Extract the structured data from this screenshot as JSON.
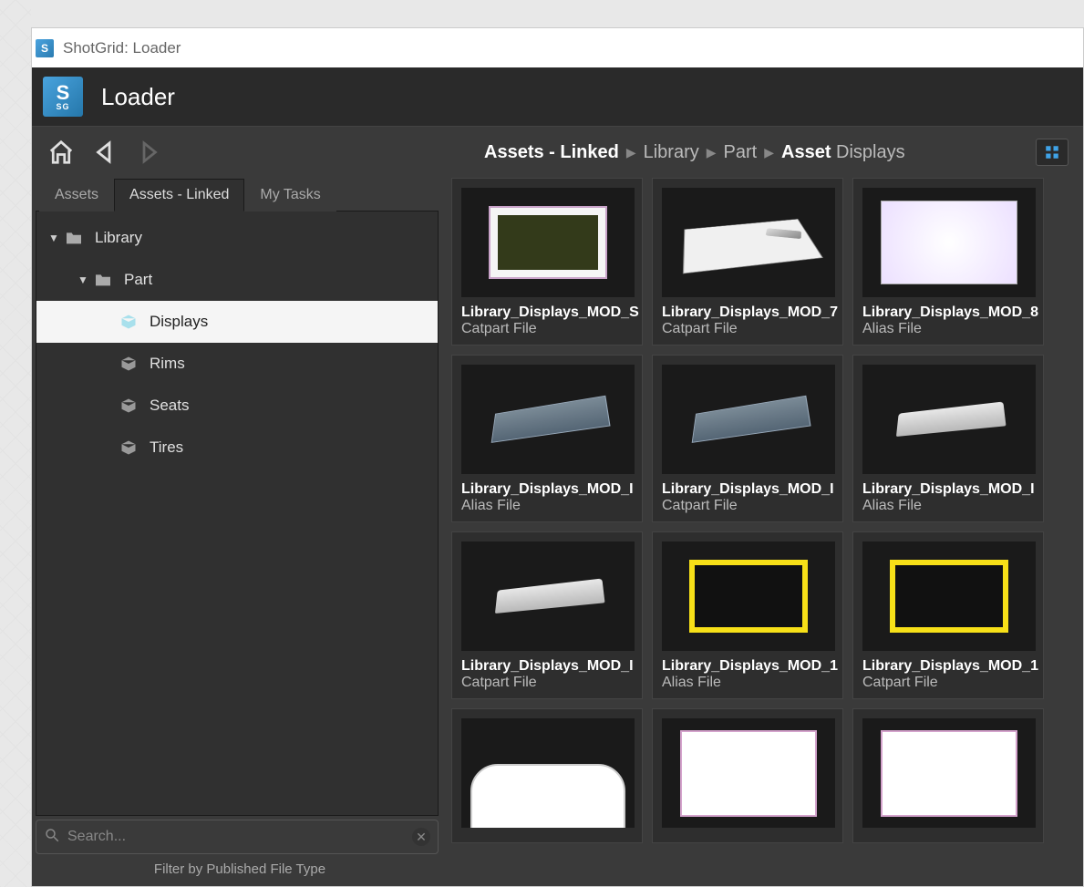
{
  "window": {
    "title": "ShotGrid: Loader"
  },
  "app": {
    "title": "Loader",
    "icon_letter": "S",
    "icon_sub": "SG"
  },
  "breadcrumb": {
    "root": "Assets - Linked",
    "mid1": "Library",
    "mid2": "Part",
    "leaf_strong": "Asset",
    "leaf": "Displays"
  },
  "tabs": {
    "assets": "Assets",
    "assets_linked": "Assets - Linked",
    "my_tasks": "My Tasks",
    "active": "assets_linked"
  },
  "tree": {
    "library": "Library",
    "part": "Part",
    "items": [
      {
        "label": "Displays",
        "selected": true
      },
      {
        "label": "Rims",
        "selected": false
      },
      {
        "label": "Seats",
        "selected": false
      },
      {
        "label": "Tires",
        "selected": false
      }
    ]
  },
  "search": {
    "placeholder": "Search..."
  },
  "filter_label": "Filter by Published File Type",
  "cards": [
    {
      "title": "Library_Displays_MOD_S",
      "sub": "Catpart File",
      "thumb": "display-white"
    },
    {
      "title": "Library_Displays_MOD_7",
      "sub": "Catpart File",
      "thumb": "skew-plate"
    },
    {
      "title": "Library_Displays_MOD_8",
      "sub": "Alias File",
      "thumb": "display-glow"
    },
    {
      "title": "Library_Displays_MOD_I",
      "sub": "Alias File",
      "thumb": "wireblock"
    },
    {
      "title": "Library_Displays_MOD_I",
      "sub": "Catpart File",
      "thumb": "wireblock"
    },
    {
      "title": "Library_Displays_MOD_I",
      "sub": "Alias File",
      "thumb": "solidblock"
    },
    {
      "title": "Library_Displays_MOD_I",
      "sub": "Catpart File",
      "thumb": "solidblock"
    },
    {
      "title": "Library_Displays_MOD_1",
      "sub": "Alias File",
      "thumb": "yellowframe"
    },
    {
      "title": "Library_Displays_MOD_1",
      "sub": "Catpart File",
      "thumb": "yellowframe"
    },
    {
      "title": "",
      "sub": "",
      "thumb": "half"
    },
    {
      "title": "",
      "sub": "",
      "thumb": "pinkframe"
    },
    {
      "title": "",
      "sub": "",
      "thumb": "pinkframe"
    }
  ]
}
